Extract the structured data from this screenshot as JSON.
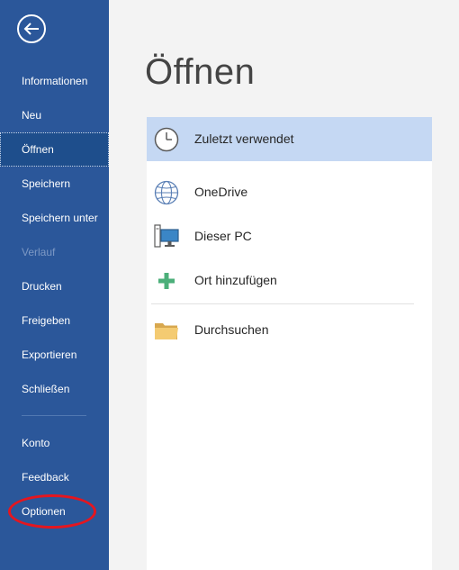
{
  "sidebar": {
    "back_icon": "back-arrow-icon",
    "items": [
      {
        "label": "Informationen"
      },
      {
        "label": "Neu"
      },
      {
        "label": "Öffnen"
      },
      {
        "label": "Speichern"
      },
      {
        "label": "Speichern unter"
      },
      {
        "label": "Verlauf"
      },
      {
        "label": "Drucken"
      },
      {
        "label": "Freigeben"
      },
      {
        "label": "Exportieren"
      },
      {
        "label": "Schließen"
      },
      {
        "label": "Konto"
      },
      {
        "label": "Feedback"
      },
      {
        "label": "Optionen"
      }
    ],
    "active_item": "Öffnen",
    "disabled_item": "Verlauf"
  },
  "main": {
    "title": "Öffnen",
    "places": [
      {
        "label": "Zuletzt verwendet",
        "icon": "clock-icon"
      },
      {
        "label": "OneDrive",
        "icon": "globe-icon"
      },
      {
        "label": "Dieser PC",
        "icon": "computer-icon"
      },
      {
        "label": "Ort hinzufügen",
        "icon": "plus-icon"
      },
      {
        "label": "Durchsuchen",
        "icon": "folder-icon"
      }
    ],
    "selected_place": "Zuletzt verwendet"
  },
  "colors": {
    "sidebar_bg": "#2b579a",
    "sidebar_active": "#1e4e8c",
    "selected_place_bg": "#c5d8f3",
    "annotation_ellipse": "#e5161f"
  }
}
